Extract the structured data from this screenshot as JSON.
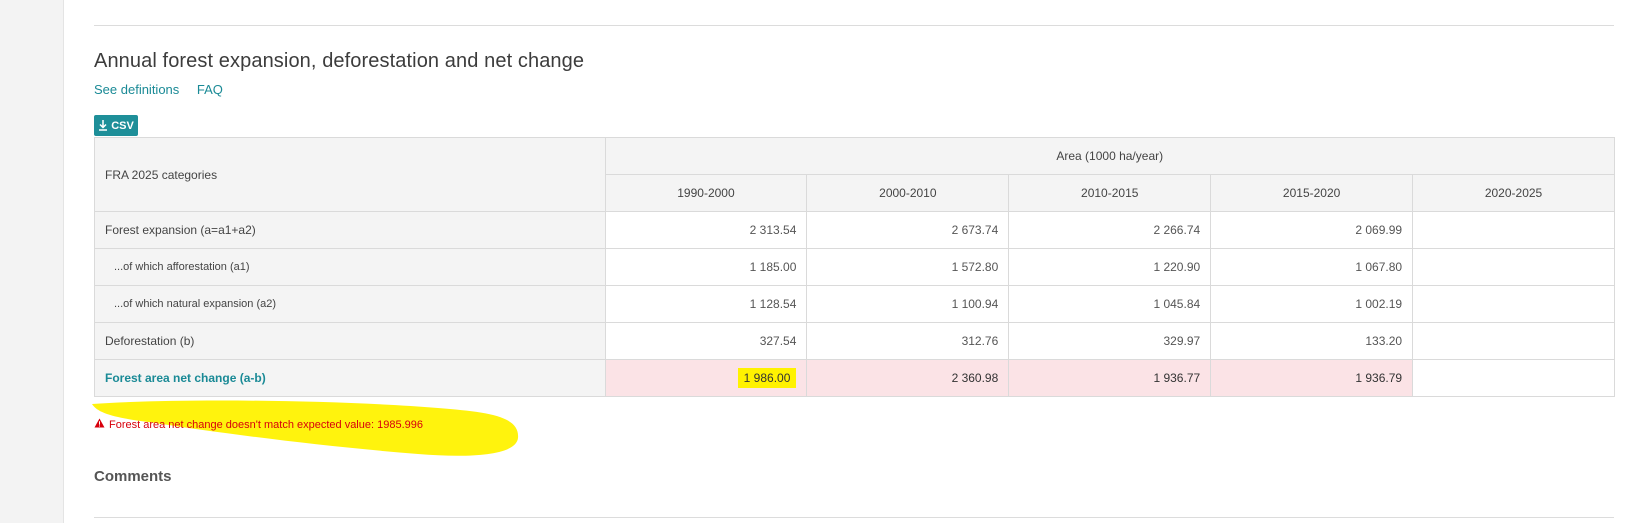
{
  "section": {
    "title": "Annual forest expansion, deforestation and net change",
    "links": [
      "See definitions",
      "FAQ"
    ],
    "csv_label": "CSV"
  },
  "table": {
    "category_header": "FRA 2025 categories",
    "area_header": "Area (1000 ha/year)",
    "years": [
      "1990-2000",
      "2000-2010",
      "2010-2015",
      "2015-2020",
      "2020-2025"
    ],
    "rows": [
      {
        "label": "Forest expansion (a=a1+a2)",
        "values": [
          "2 313.54",
          "2 673.74",
          "2 266.74",
          "2 069.99",
          ""
        ]
      },
      {
        "label": "...of which afforestation (a1)",
        "values": [
          "1 185.00",
          "1 572.80",
          "1 220.90",
          "1 067.80",
          ""
        ]
      },
      {
        "label": "...of which natural expansion (a2)",
        "values": [
          "1 128.54",
          "1 100.94",
          "1 045.84",
          "1 002.19",
          ""
        ]
      },
      {
        "label": "Deforestation (b)",
        "values": [
          "327.54",
          "312.76",
          "329.97",
          "133.20",
          ""
        ]
      },
      {
        "label": "Forest area net change (a-b)",
        "values": [
          "1 986.00",
          "2 360.98",
          "1 936.77",
          "1 936.79",
          ""
        ]
      }
    ]
  },
  "error": {
    "message": "Forest area net change doesn't match expected value: 1985.996",
    "icon": "warning-icon",
    "color": "#d8000c"
  },
  "comments": {
    "title": "Comments"
  },
  "colors": {
    "accent": "#1e8f99",
    "error_cell_bg": "#fbe3e6",
    "highlighter": "#fff200"
  }
}
